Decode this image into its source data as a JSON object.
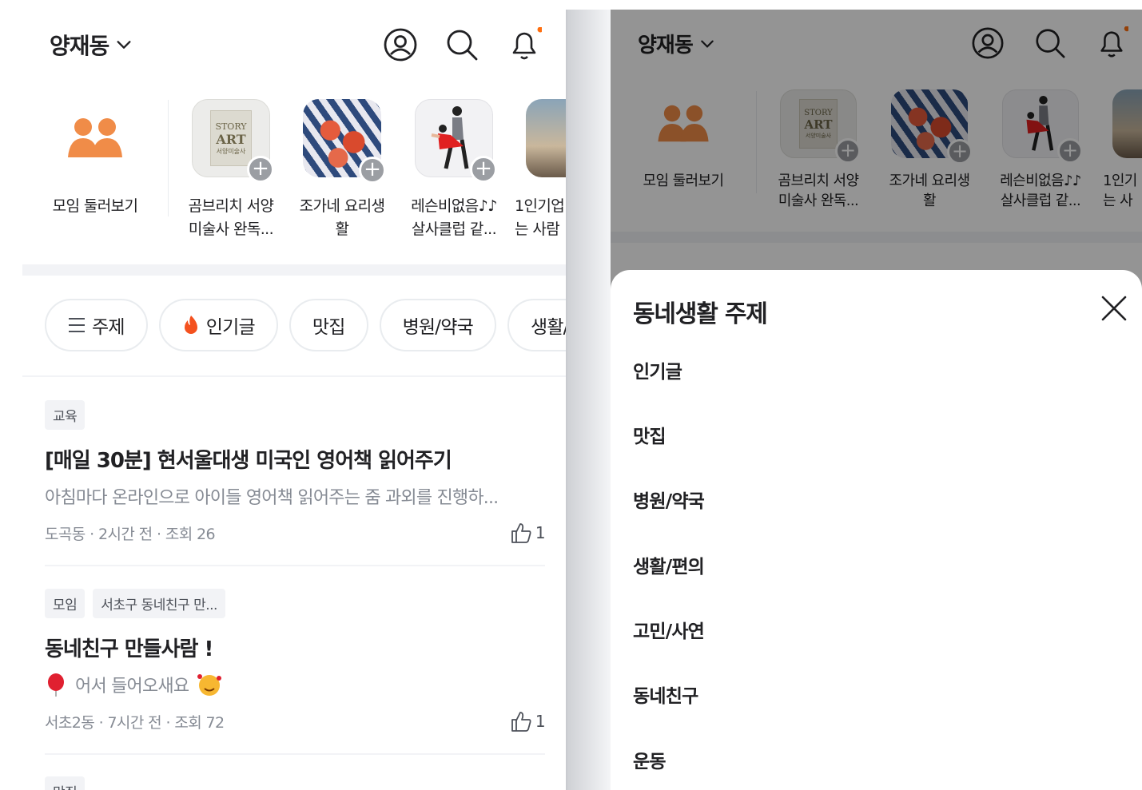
{
  "location": "양재동",
  "stories": [
    {
      "label_line1": "모임 둘러보기",
      "label_line2": ""
    },
    {
      "label_line1": "곰브리치 서양",
      "label_line2": "미술사 완독..."
    },
    {
      "label_line1": "조가네 요리생",
      "label_line2": "활"
    },
    {
      "label_line1": "레슨비없음♪♪",
      "label_line2": "살사클럽 같..."
    },
    {
      "label_line1": "1인기업",
      "label_line2": "는 사람"
    }
  ],
  "book_cover": {
    "line1": "STORY",
    "line2": "ART",
    "line3": "서양미술사"
  },
  "right_stories": [
    {
      "label_line1": "1인기",
      "label_line2": "는 사"
    }
  ],
  "chips": [
    {
      "label": "주제",
      "icon": "menu-icon"
    },
    {
      "label": "인기글",
      "icon": "fire-icon"
    },
    {
      "label": "맛집"
    },
    {
      "label": "병원/약국"
    },
    {
      "label": "생활/"
    }
  ],
  "posts": [
    {
      "tags": [
        "교육"
      ],
      "title": "[매일 30분] 현서울대생 미국인 영어책 읽어주기",
      "body": "아침마다 온라인으로 아이들 영어책 읽어주는 줌 과외를 진행하...",
      "meta": "도곡동 · 2시간 전 · 조회 26",
      "likes": "1"
    },
    {
      "tags": [
        "모임",
        "서초구 동네친구 만..."
      ],
      "title": "동네친구 만들사람 !",
      "body": "어서 들어오새요",
      "meta": "서초2동 · 7시간 전 · 조회 72",
      "likes": "1"
    },
    {
      "tags": [
        "맛집"
      ]
    }
  ],
  "sheet": {
    "title": "동네생활 주제",
    "topics": [
      "인기글",
      "맛집",
      "병원/약국",
      "생활/편의",
      "고민/사연",
      "동네친구",
      "운동"
    ]
  },
  "colors": {
    "accent": "#ff6f0f",
    "fire": "#f4511e",
    "text": "#212124",
    "muted": "#868b94"
  }
}
